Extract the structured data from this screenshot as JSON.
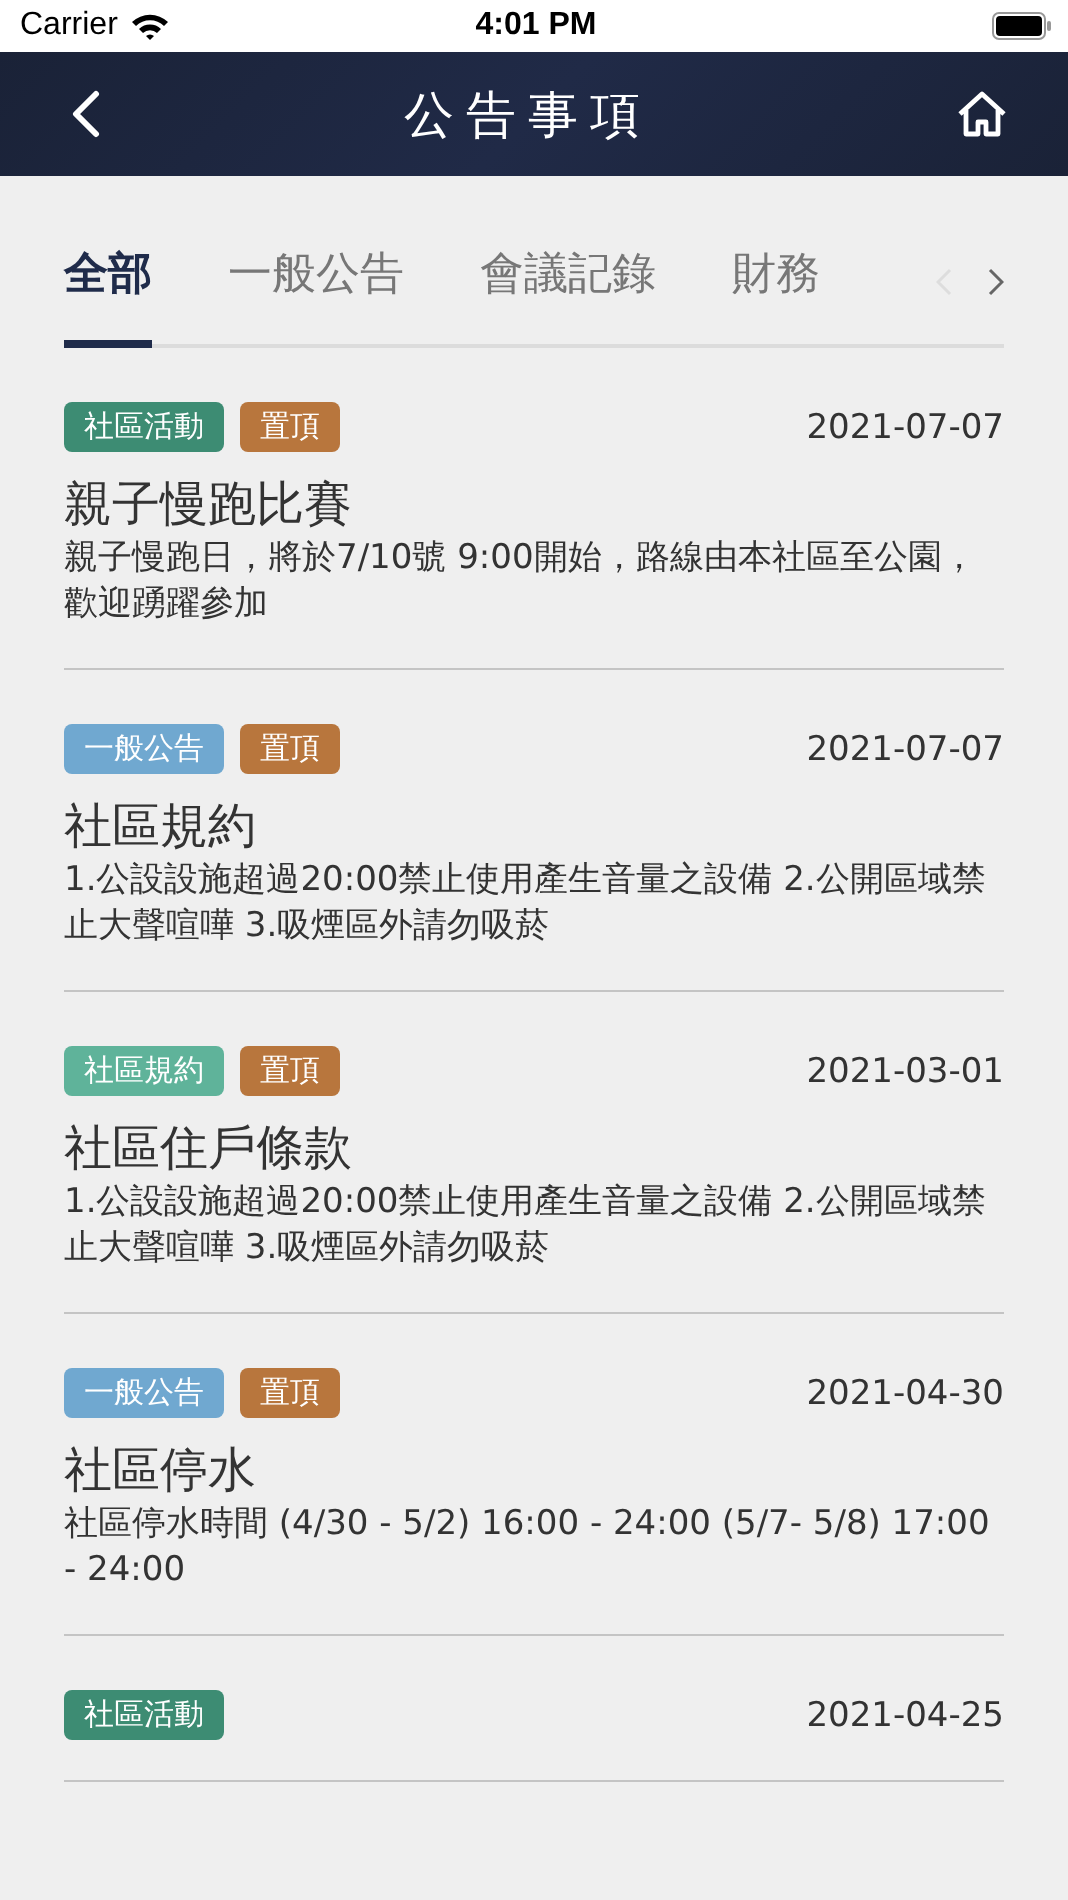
{
  "status_bar": {
    "carrier": "Carrier",
    "time": "4:01 PM"
  },
  "nav": {
    "title": "公告事項"
  },
  "tabs": [
    {
      "label": "全部",
      "selected": true
    },
    {
      "label": "一般公告",
      "selected": false
    },
    {
      "label": "會議記錄",
      "selected": false
    },
    {
      "label": "財務",
      "selected": false
    }
  ],
  "announcements": [
    {
      "tags": [
        {
          "label": "社區活動",
          "color": "#3d8c73"
        },
        {
          "label": "置頂",
          "color": "#b8763d"
        }
      ],
      "date": "2021-07-07",
      "title": "親子慢跑比賽",
      "body": "親子慢跑日，將於7/10號 9:00開始，路線由本社區至公園，歡迎踴躍參加"
    },
    {
      "tags": [
        {
          "label": "一般公告",
          "color": "#70a8d0"
        },
        {
          "label": "置頂",
          "color": "#b8763d"
        }
      ],
      "date": "2021-07-07",
      "title": "社區規約",
      "body": "1.公設設施超過20:00禁止使用產生音量之設備 2.公開區域禁止大聲喧嘩 3.吸煙區外請勿吸菸"
    },
    {
      "tags": [
        {
          "label": "社區規約",
          "color": "#5fb39a"
        },
        {
          "label": "置頂",
          "color": "#b8763d"
        }
      ],
      "date": "2021-03-01",
      "title": "社區住戶條款",
      "body": "1.公設設施超過20:00禁止使用產生音量之設備 2.公開區域禁止大聲喧嘩 3.吸煙區外請勿吸菸"
    },
    {
      "tags": [
        {
          "label": "一般公告",
          "color": "#70a8d0"
        },
        {
          "label": "置頂",
          "color": "#b8763d"
        }
      ],
      "date": "2021-04-30",
      "title": "社區停水",
      "body": "社區停水時間 (4/30 - 5/2) 16:00 - 24:00 (5/7- 5/8) 17:00 - 24:00"
    },
    {
      "tags": [
        {
          "label": "社區活動",
          "color": "#3d8c73"
        }
      ],
      "date": "2021-04-25"
    }
  ]
}
